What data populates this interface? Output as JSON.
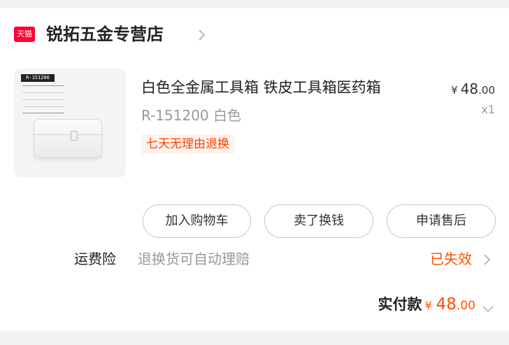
{
  "store": {
    "badge": "天猫",
    "name": "锐拓五金专营店",
    "chevron_icon": "chevron-right-icon"
  },
  "product": {
    "image_tag": "R-151200",
    "title": "白色全金属工具箱 铁皮工具箱医药箱",
    "sku": "R-151200 白色",
    "return_policy": "七天无理由退换",
    "price_symbol": "¥",
    "price_int": "48",
    "price_dec": ".00",
    "quantity": "x1"
  },
  "actions": {
    "add_to_cart": "加入购物车",
    "resell": "卖了换钱",
    "after_sales": "申请售后"
  },
  "shipping_insurance": {
    "label": "运费险",
    "description": "退换货可自动理赔",
    "status": "已失效"
  },
  "total": {
    "label": "实付款",
    "symbol": "¥",
    "amount_int": "48",
    "amount_dec": ".00"
  },
  "colors": {
    "accent": "#ff5000",
    "tmall_red": "#ff0036",
    "muted_text": "#999999"
  }
}
